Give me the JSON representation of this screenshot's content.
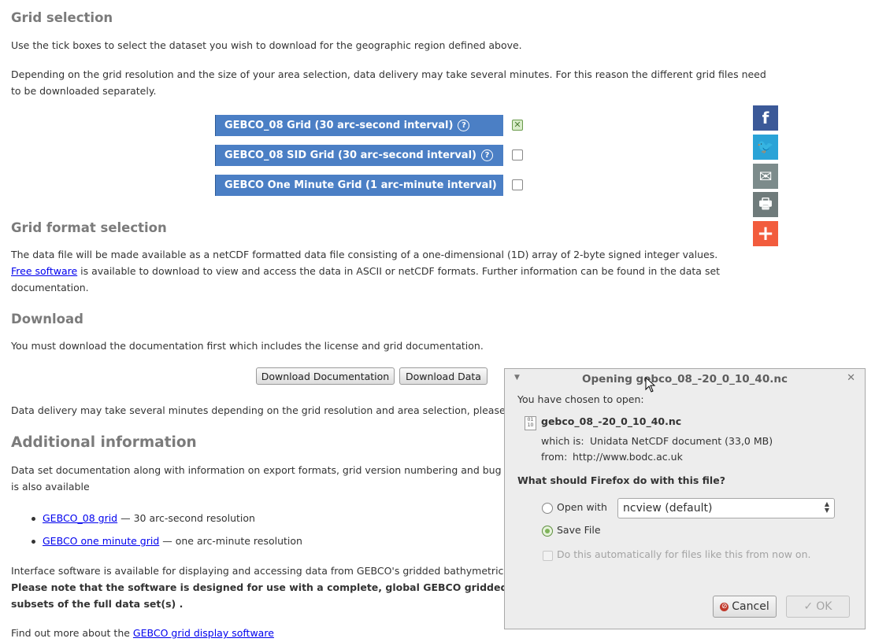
{
  "grid_selection": {
    "heading": "Grid selection",
    "intro": "Use the tick boxes to select the dataset you wish to download for the geographic region defined above.",
    "note_line1": "Depending on the grid resolution and the size of your area selection, data delivery may take several minutes. For this reason the different grid files need",
    "note_line2": "to be downloaded separately.",
    "grids": [
      {
        "label": "GEBCO_08 Grid (30 arc-second interval)",
        "help": "?",
        "checked": true
      },
      {
        "label": "GEBCO_08 SID Grid (30 arc-second interval)",
        "help": "?",
        "checked": false
      },
      {
        "label": "GEBCO One Minute Grid (1 arc-minute interval)",
        "help": "?",
        "checked": false
      }
    ]
  },
  "social": [
    {
      "icon": "facebook-icon",
      "glyph": "f",
      "color": "#3b5998"
    },
    {
      "icon": "twitter-icon",
      "glyph": "🐦",
      "color": "#2aa3d7"
    },
    {
      "icon": "email-icon",
      "glyph": "✉",
      "color": "#7c8b8b"
    },
    {
      "icon": "print-icon",
      "glyph": "🖶",
      "color": "#6f7b7b"
    },
    {
      "icon": "share-plus-icon",
      "glyph": "+",
      "color": "#f25c3d"
    }
  ],
  "grid_format": {
    "heading": "Grid format selection",
    "line1": "The data file will be made available as a netCDF formatted data file consisting of a one-dimensional (1D) array of 2-byte signed integer values.",
    "link": "Free software",
    "line2_rest": " is available to download to view and access the data in ASCII or netCDF formats. Further information can be found in the data set",
    "line3": "documentation."
  },
  "download": {
    "heading": "Download",
    "text": "You must download the documentation first which includes the license and grid documentation.",
    "doc_button": "Download Documentation",
    "data_button": "Download Data",
    "delivery_note": "Data delivery may take several minutes depending on the grid resolution and area selection, please be pa"
  },
  "additional": {
    "heading": "Additional information",
    "line1": "Data set documentation along with information on export formats, grid version numbering and bug alerts",
    "line2": "is also available",
    "links": [
      {
        "link": "GEBCO_08 grid",
        "rest": " — 30 arc-second resolution"
      },
      {
        "link": "GEBCO one minute grid",
        "rest": " — one arc-minute resolution"
      }
    ],
    "interface_line": "Interface software is available for displaying and accessing data from GEBCO's gridded bathymetric data s",
    "bold_line1": "Please note that the software is designed for use with a complete, global GEBCO gridded data",
    "bold_line2": "subsets of the full data set(s) .",
    "find_out": "Find out more about the ",
    "find_out_link": "GEBCO grid display software"
  },
  "dialog": {
    "title": "Opening gebco_08_-20_0_10_40.nc",
    "chosen": "You have chosen to open:",
    "filename": "gebco_08_-20_0_10_40.nc",
    "which_is_label": "which is:",
    "which_is_value": "Unidata NetCDF document (33,0 MB)",
    "from_label": "from:",
    "from_value": "http://www.bodc.ac.uk",
    "question": "What should Firefox do with this file?",
    "open_with_label": "Open with",
    "open_with_value": "ncview (default)",
    "save_file_label": "Save File",
    "auto_label": "Do this automatically for files like this from now on.",
    "cancel": "Cancel",
    "ok": "OK",
    "selected_option": "Save File"
  }
}
